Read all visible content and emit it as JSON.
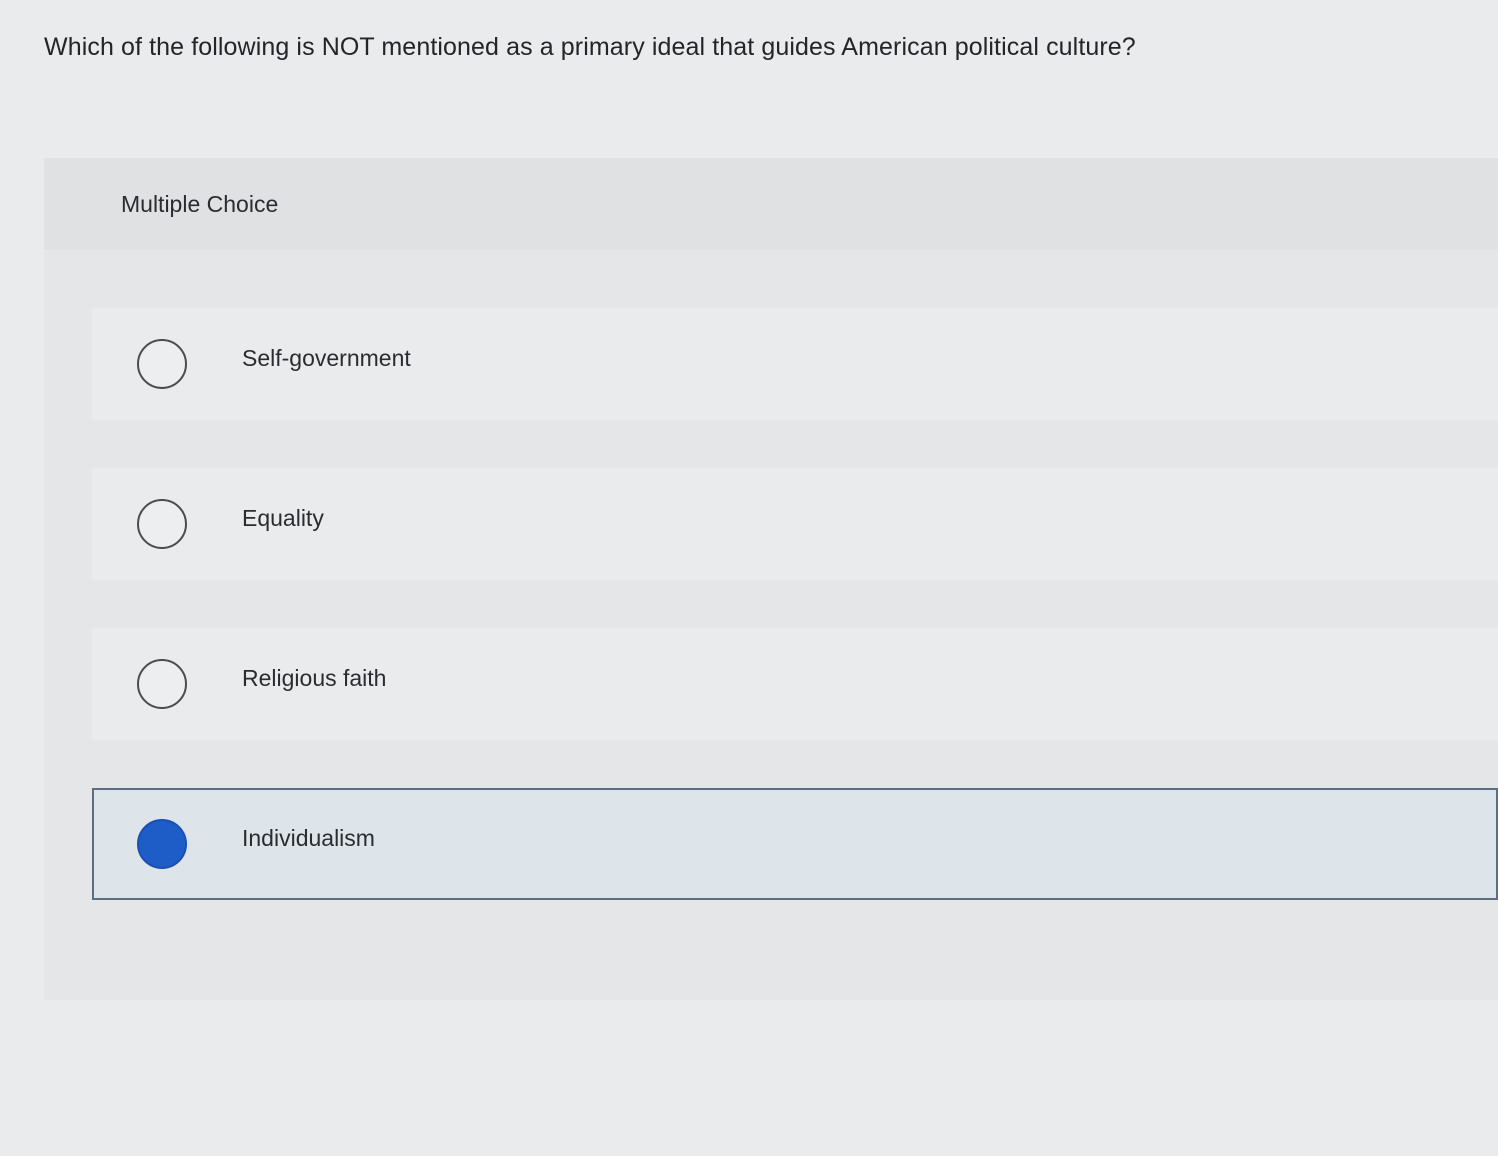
{
  "question": {
    "text": "Which of the following is NOT mentioned as a primary ideal that guides American political culture?"
  },
  "card": {
    "header_label": "Multiple Choice",
    "options": [
      {
        "label": "Self-government",
        "selected": false
      },
      {
        "label": "Equality",
        "selected": false
      },
      {
        "label": "Religious faith",
        "selected": false
      },
      {
        "label": "Individualism",
        "selected": true
      }
    ]
  },
  "colors": {
    "selected_radio": "#1e5cc8",
    "selected_border": "#5b6e82",
    "selected_background": "#dde5ea"
  }
}
